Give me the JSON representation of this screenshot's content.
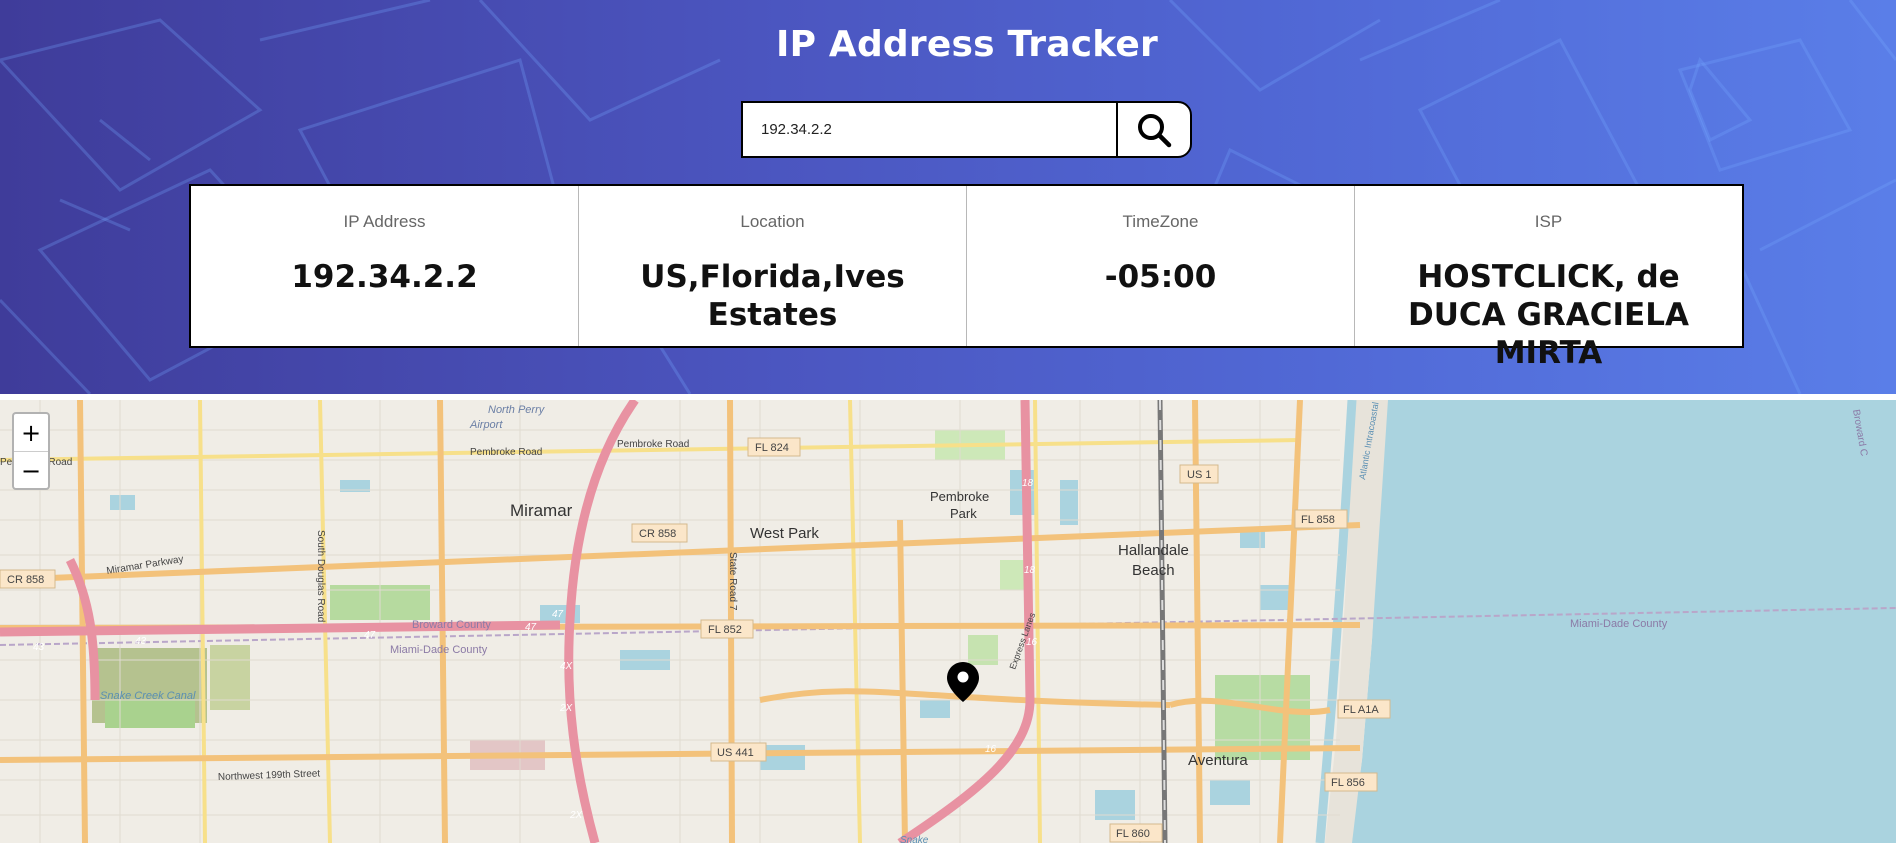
{
  "header": {
    "title": "IP Address Tracker",
    "search_value": "192.34.2.2",
    "search_icon": "search-icon"
  },
  "info": [
    {
      "label": "IP Address",
      "value": "192.34.2.2"
    },
    {
      "label": "Location",
      "value": "US,Florida,Ives Estates"
    },
    {
      "label": "TimeZone",
      "value": "-05:00"
    },
    {
      "label": "ISP",
      "value": "HOSTCLICK, de DUCA GRACIELA MIRTA"
    }
  ],
  "map": {
    "zoom_in_label": "+",
    "zoom_out_label": "−",
    "marker_icon": "location-pin-icon",
    "places": {
      "north_perry": "North Perry",
      "airport": "Airport",
      "pembroke_road_w": "Pembroke Road",
      "pembroke_road": "Pembroke Road",
      "fl824": "FL 824",
      "south_douglas": "South Douglas Road",
      "miramar": "Miramar",
      "cr858_mid": "CR 858",
      "west_park": "West Park",
      "pembroke_park_1": "Pembroke",
      "pembroke_park_2": "Park",
      "us1": "US 1",
      "fl858_e": "FL 858",
      "hallandale_1": "Hallandale",
      "hallandale_2": "Beach",
      "cr858_w": "CR 858",
      "miramar_parkway": "Miramar Parkway",
      "state_road_7": "State Road 7",
      "broward_county": "Broward County",
      "miami_dade_county": "Miami-Dade County",
      "fl852": "FL 852",
      "snake_creek": "Snake Creek Canal",
      "us441": "US 441",
      "nw199": "Northwest 199th Street",
      "aventura": "Aventura",
      "fla1a": "FL A1A",
      "fl856": "FL 856",
      "fl860": "FL 860",
      "miami_dade_county_e": "Miami-Dade County",
      "broward_e": "Broward C",
      "atlantic": "Atlantic Intracoastal",
      "r43": "43",
      "r47a": "47",
      "r47b": "47",
      "r47c": "47",
      "r4x": "4X",
      "r2x": "2X",
      "r2x_b": "2X",
      "r18a": "18",
      "r18b": "18",
      "r16a": "16",
      "r16b": "16",
      "express": "Express Lanes",
      "snake": "Snake"
    }
  }
}
